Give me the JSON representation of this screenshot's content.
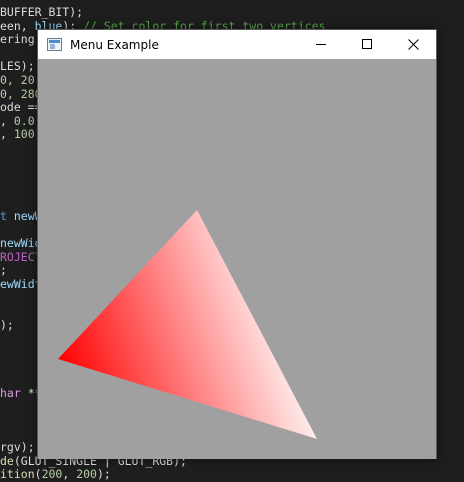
{
  "editor": {
    "lines": [
      {
        "segments": [
          {
            "t": "BUFFER_BIT);",
            "c": ""
          }
        ]
      },
      {
        "segments": [
          {
            "t": "een, ",
            "c": ""
          },
          {
            "t": "blue",
            "c": "tok-id"
          },
          {
            "t": "); ",
            "c": ""
          },
          {
            "t": "// Set color for first two vertices",
            "c": "tok-comment"
          }
        ]
      },
      {
        "segments": [
          {
            "t": "ering",
            "c": ""
          }
        ]
      },
      {
        "segments": [
          {
            "t": "",
            "c": ""
          }
        ]
      },
      {
        "segments": [
          {
            "t": "LES);",
            "c": ""
          }
        ]
      },
      {
        "segments": [
          {
            "t": "0, 20",
            "c": "tok-num"
          }
        ]
      },
      {
        "segments": [
          {
            "t": "0, 280",
            "c": "tok-num"
          }
        ]
      },
      {
        "segments": [
          {
            "t": "ode ==",
            "c": ""
          }
        ]
      },
      {
        "segments": [
          {
            "t": ", ",
            "c": ""
          },
          {
            "t": "0.0",
            "c": "tok-num"
          }
        ]
      },
      {
        "segments": [
          {
            "t": ", ",
            "c": ""
          },
          {
            "t": "100",
            "c": "tok-num"
          },
          {
            "t": ")",
            "c": ""
          }
        ]
      },
      {
        "segments": [
          {
            "t": "",
            "c": ""
          }
        ]
      },
      {
        "segments": [
          {
            "t": "",
            "c": ""
          }
        ]
      },
      {
        "segments": [
          {
            "t": "",
            "c": ""
          }
        ]
      },
      {
        "segments": [
          {
            "t": "",
            "c": ""
          }
        ]
      },
      {
        "segments": [
          {
            "t": "",
            "c": ""
          }
        ]
      },
      {
        "segments": [
          {
            "t": "t ",
            "c": "tok-type"
          },
          {
            "t": "newW",
            "c": "tok-id"
          }
        ]
      },
      {
        "segments": [
          {
            "t": "",
            "c": ""
          }
        ]
      },
      {
        "segments": [
          {
            "t": "newWid",
            "c": "tok-id"
          }
        ]
      },
      {
        "segments": [
          {
            "t": "ROJECT",
            "c": "tok-macro"
          }
        ]
      },
      {
        "segments": [
          {
            "t": ";",
            "c": ""
          }
        ]
      },
      {
        "segments": [
          {
            "t": "ewWidt",
            "c": "tok-id"
          }
        ]
      },
      {
        "segments": [
          {
            "t": "",
            "c": ""
          }
        ]
      },
      {
        "segments": [
          {
            "t": "",
            "c": ""
          }
        ]
      },
      {
        "segments": [
          {
            "t": ");",
            "c": ""
          }
        ]
      },
      {
        "segments": [
          {
            "t": "",
            "c": ""
          }
        ]
      },
      {
        "segments": [
          {
            "t": "",
            "c": ""
          }
        ]
      },
      {
        "segments": [
          {
            "t": "",
            "c": ""
          }
        ]
      },
      {
        "segments": [
          {
            "t": "",
            "c": ""
          }
        ]
      },
      {
        "segments": [
          {
            "t": "har ",
            "c": "tok-kw"
          },
          {
            "t": "**",
            "c": ""
          }
        ]
      },
      {
        "segments": [
          {
            "t": "",
            "c": ""
          }
        ]
      },
      {
        "segments": [
          {
            "t": "",
            "c": ""
          }
        ]
      },
      {
        "segments": [
          {
            "t": "",
            "c": ""
          }
        ]
      },
      {
        "segments": [
          {
            "t": "rgv);",
            "c": ""
          }
        ]
      },
      {
        "segments": [
          {
            "t": "de",
            "c": "tok-fn"
          },
          {
            "t": "(GLUT_SINGLE | GLUT_RGB);",
            "c": ""
          }
        ]
      },
      {
        "segments": [
          {
            "t": "ition",
            "c": "tok-fn"
          },
          {
            "t": "(",
            "c": ""
          },
          {
            "t": "200",
            "c": "tok-num"
          },
          {
            "t": ", ",
            "c": ""
          },
          {
            "t": "200",
            "c": "tok-num"
          },
          {
            "t": ");",
            "c": ""
          }
        ]
      }
    ]
  },
  "window": {
    "title": "Menu Example",
    "minimize_icon": "minimize-icon",
    "maximize_icon": "maximize-icon",
    "close_icon": "close-icon",
    "background_color": "#a0a0a0"
  },
  "triangle": {
    "vertex_colors": [
      "#ff0000",
      "#ffffff",
      "#ffffff"
    ]
  }
}
